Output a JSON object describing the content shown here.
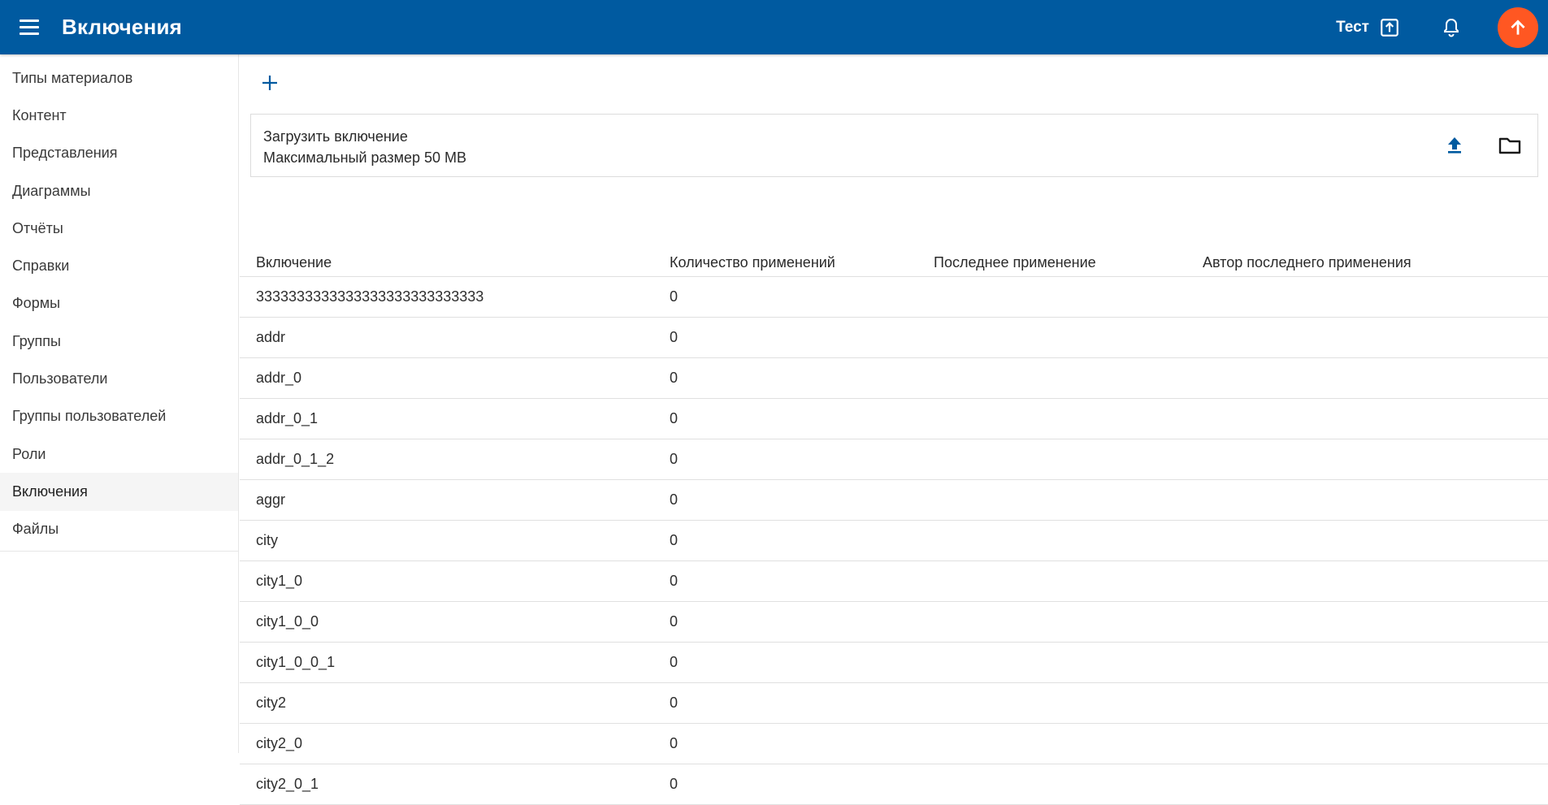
{
  "header": {
    "title": "Включения",
    "user": "Тест",
    "colors": {
      "bar": "#005aa0",
      "fab": "#ff5722"
    },
    "icons": [
      "menu-icon",
      "export-icon",
      "bell-icon",
      "arrow-up-icon"
    ]
  },
  "sidebar": {
    "active": "Включения",
    "items": [
      {
        "label": "Типы материалов"
      },
      {
        "label": "Контент"
      },
      {
        "label": "Представления"
      },
      {
        "label": "Диаграммы"
      },
      {
        "label": "Отчёты"
      },
      {
        "label": "Справки"
      },
      {
        "label": "Формы"
      },
      {
        "label": "Группы"
      },
      {
        "label": "Пользователи"
      },
      {
        "label": "Группы пользователей"
      },
      {
        "label": "Роли"
      },
      {
        "label": "Включения"
      },
      {
        "label": "Файлы"
      }
    ]
  },
  "upload": {
    "title": "Загрузить включение",
    "limit": "Максимальный размер 50 MB"
  },
  "table": {
    "columns": [
      "Включение",
      "Количество применений",
      "Последнее применение",
      "Автор последнего применения"
    ],
    "rows": [
      {
        "name": "3333333333333333333333333333",
        "count": "0",
        "last": "",
        "author": ""
      },
      {
        "name": "addr",
        "count": "0",
        "last": "",
        "author": ""
      },
      {
        "name": "addr_0",
        "count": "0",
        "last": "",
        "author": ""
      },
      {
        "name": "addr_0_1",
        "count": "0",
        "last": "",
        "author": ""
      },
      {
        "name": "addr_0_1_2",
        "count": "0",
        "last": "",
        "author": ""
      },
      {
        "name": "aggr",
        "count": "0",
        "last": "",
        "author": ""
      },
      {
        "name": "city",
        "count": "0",
        "last": "",
        "author": ""
      },
      {
        "name": "city1_0",
        "count": "0",
        "last": "",
        "author": ""
      },
      {
        "name": "city1_0_0",
        "count": "0",
        "last": "",
        "author": ""
      },
      {
        "name": "city1_0_0_1",
        "count": "0",
        "last": "",
        "author": ""
      },
      {
        "name": "city2",
        "count": "0",
        "last": "",
        "author": ""
      },
      {
        "name": "city2_0",
        "count": "0",
        "last": "",
        "author": ""
      },
      {
        "name": "city2_0_1",
        "count": "0",
        "last": "",
        "author": ""
      }
    ]
  }
}
